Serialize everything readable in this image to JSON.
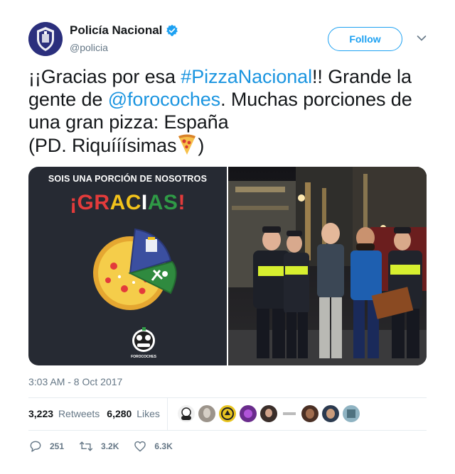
{
  "author": {
    "name": "Policía Nacional",
    "handle": "@policia",
    "verified": true
  },
  "follow_label": "Follow",
  "tweet": {
    "prefix": "¡¡Gracias por esa ",
    "hashtag": "#PizzaNacional",
    "middle": "!! Grande la gente de ",
    "mention": "@forocoches",
    "suffix": ". Muchas porciones de una gran pizza: España",
    "ps": "(PD. Riquííísimas",
    "ps_close": ")"
  },
  "media": {
    "left_banner": "SOIS UNA PORCIÓN DE NOSOTROS",
    "left_title": "¡GRACIAS!",
    "left_title_colors": [
      "#e33b3b",
      "#f2c21b",
      "#ffffff",
      "#2f9a46",
      "#e33b3b"
    ],
    "badge": "FOROCOCHES"
  },
  "timestamp": "3:03 AM - 8 Oct 2017",
  "stats": {
    "retweets_count": "3,223",
    "retweets_label": "Retweets",
    "likes_count": "6,280",
    "likes_label": "Likes"
  },
  "liker_avatars": 9,
  "actions": {
    "replies": "251",
    "retweets": "3.2K",
    "likes": "6.3K"
  },
  "colors": {
    "accent": "#1da1f2",
    "link": "#1b95e0",
    "muted": "#657786"
  }
}
